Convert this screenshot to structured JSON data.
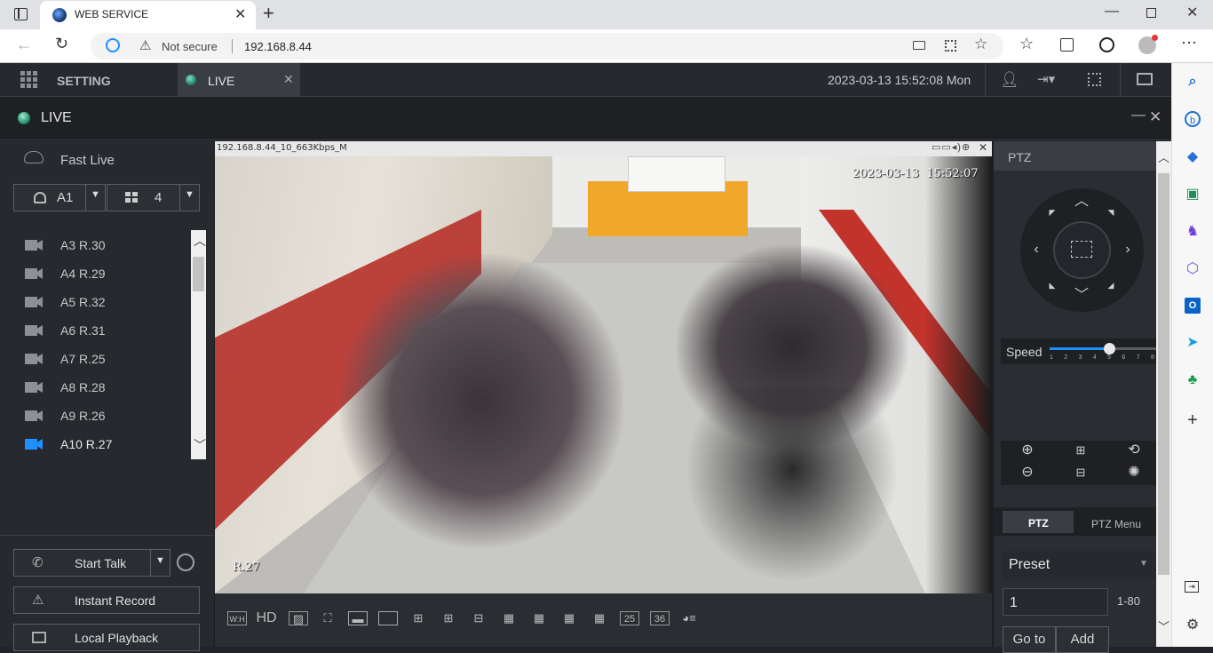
{
  "browser": {
    "tab_title": "WEB SERVICE",
    "security_label": "Not secure",
    "url": "192.168.8.44"
  },
  "topnav": {
    "setting_label": "SETTING",
    "live_tab_label": "LIVE",
    "datetime": "2023-03-13 15:52:08 Mon"
  },
  "livebar": {
    "title": "LIVE"
  },
  "left": {
    "fast_live_label": "Fast Live",
    "group_value": "A1",
    "split_value": "4",
    "cameras": [
      {
        "label": "A3 R.30"
      },
      {
        "label": "A4 R.29"
      },
      {
        "label": "A5 R.32"
      },
      {
        "label": "A6 R.31"
      },
      {
        "label": "A7 R.25"
      },
      {
        "label": "A8 R.28"
      },
      {
        "label": "A9 R.26"
      },
      {
        "label": "A10 R.27"
      }
    ],
    "start_talk_label": "Start Talk",
    "instant_record_label": "Instant Record",
    "local_playback_label": "Local Playback"
  },
  "video": {
    "stream_info": "192.168.8.44_10_663Kbps_M",
    "osd_timestamp": "2023-03-13  15:52:07",
    "osd_channel": "R.27"
  },
  "bottom": {
    "hd_label": "HD",
    "split25_label": "25",
    "split36_label": "36"
  },
  "ptz": {
    "title": "PTZ",
    "speed_label": "Speed",
    "speed_ticks": [
      "1",
      "2",
      "3",
      "4",
      "5",
      "6",
      "7",
      "8"
    ],
    "speed_value": 5,
    "tab_ptz": "PTZ",
    "tab_menu": "PTZ Menu",
    "preset_label": "Preset",
    "preset_value": "1",
    "preset_range": "1-80",
    "goto_label": "Go to",
    "add_label": "Add"
  },
  "colors": {
    "accent_blue": "#1e90ff",
    "app_bg": "#1b1d21",
    "panel_bg": "#26292e"
  }
}
